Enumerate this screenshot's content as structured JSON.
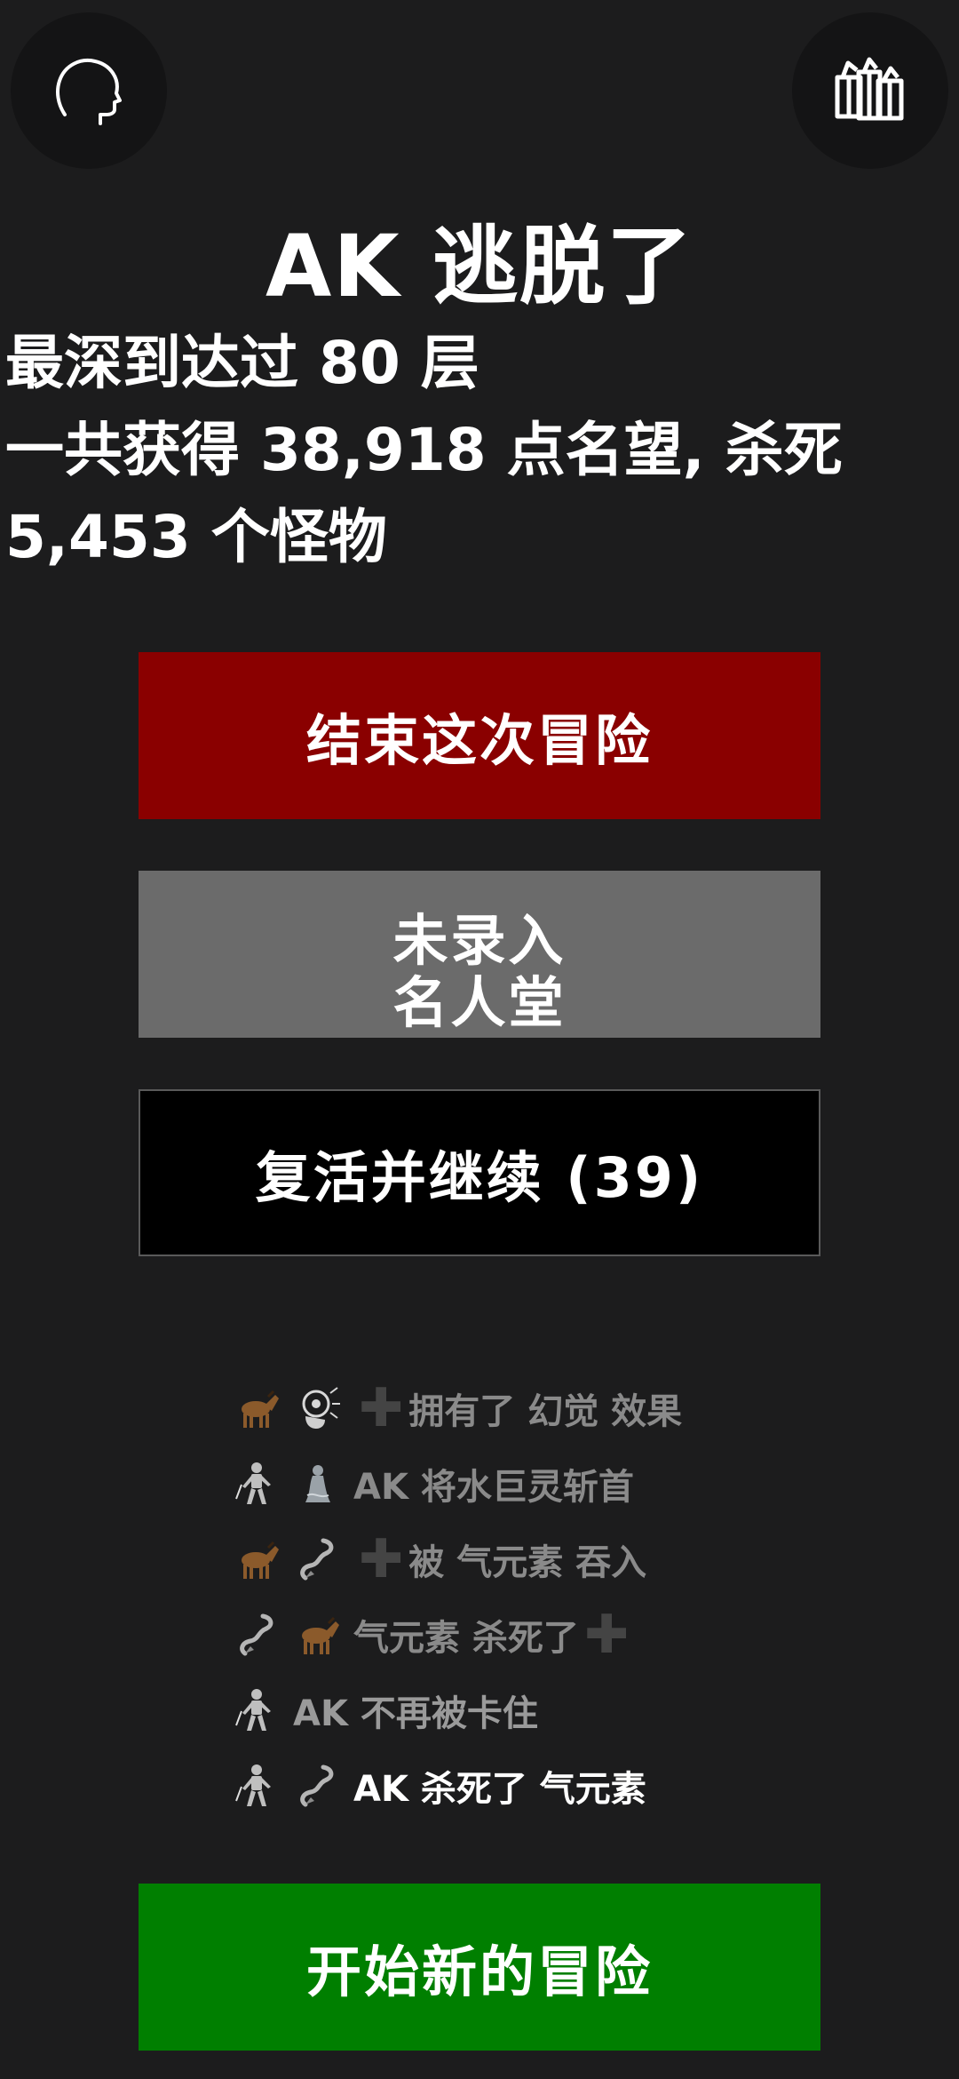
{
  "header": {
    "left_icon": "head-profile-icon",
    "right_icon": "gift-boxes-icon"
  },
  "title": "AK 逃脱了",
  "summary": {
    "line1": "最深到达过 80 层",
    "line2": "一共获得 38,918 点名望, 杀死",
    "line3": "5,453 个怪物"
  },
  "buttons": {
    "end_label": "结束这次冒险",
    "hall_line1": "未录入",
    "hall_line2": "名人堂",
    "revive_label": "复活并继续 (39)",
    "new_label": "开始新的冒险"
  },
  "log": [
    {
      "icons": [
        "horse-icon",
        "mind-blast-icon"
      ],
      "plus_before": true,
      "text": "拥有了 幻觉 效果",
      "plus_after": false,
      "color": "#8a8a8a"
    },
    {
      "icons": [
        "knight-icon",
        "water-elemental-icon"
      ],
      "plus_before": false,
      "text": "AK 将水巨灵斩首",
      "plus_after": false,
      "color": "#8a8a8a"
    },
    {
      "icons": [
        "horse-icon",
        "air-elemental-icon"
      ],
      "plus_before": true,
      "text": "被 气元素 吞入",
      "plus_after": false,
      "color": "#8a8a8a"
    },
    {
      "icons": [
        "air-elemental-icon",
        "horse-icon"
      ],
      "plus_before": false,
      "text": "气元素 杀死了",
      "plus_after": true,
      "color": "#8a8a8a"
    },
    {
      "icons": [
        "knight-icon"
      ],
      "plus_before": false,
      "text": "AK 不再被卡住",
      "plus_after": false,
      "color": "#9a9a9a"
    },
    {
      "icons": [
        "knight-icon",
        "air-elemental-icon"
      ],
      "plus_before": false,
      "text": "AK 杀死了 气元素",
      "plus_after": false,
      "color": "#ffffff"
    }
  ],
  "colors": {
    "background": "#1c1c1d",
    "end_button": "#8a0000",
    "hall_button": "#6b6b6b",
    "revive_button": "#000000",
    "new_button": "#007f00"
  }
}
